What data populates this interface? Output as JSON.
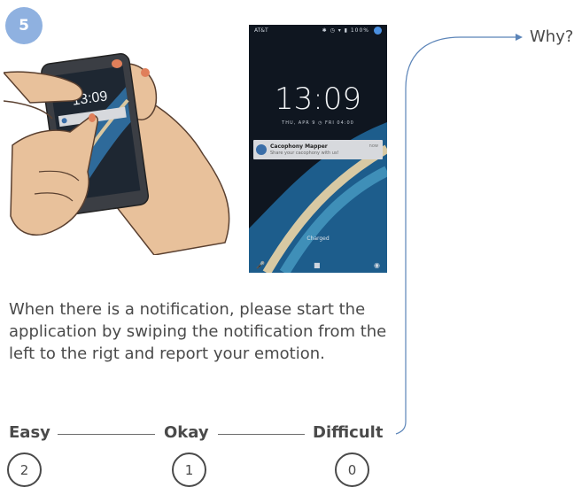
{
  "step": {
    "number": "5"
  },
  "lockscreen": {
    "carrier": "AT&T",
    "status_icons": "✱ ◷ ▾ ▮ 100%",
    "time": "13:09",
    "date": "THU, APR 9 ◷ FRI 04:00",
    "notification": {
      "title": "Cacophony Mapper",
      "subtitle": "Share your cacophony with us!",
      "time": "now"
    },
    "charged_text": "Charged"
  },
  "instruction": {
    "text": "When there is a notification, please start the application by swiping the notification from the left to the rigt and report your emotion."
  },
  "rating": {
    "labels": [
      "Easy",
      "Okay",
      "Difficult"
    ],
    "values": [
      "2",
      "1",
      "0"
    ]
  },
  "followup": {
    "label": "Why?"
  }
}
